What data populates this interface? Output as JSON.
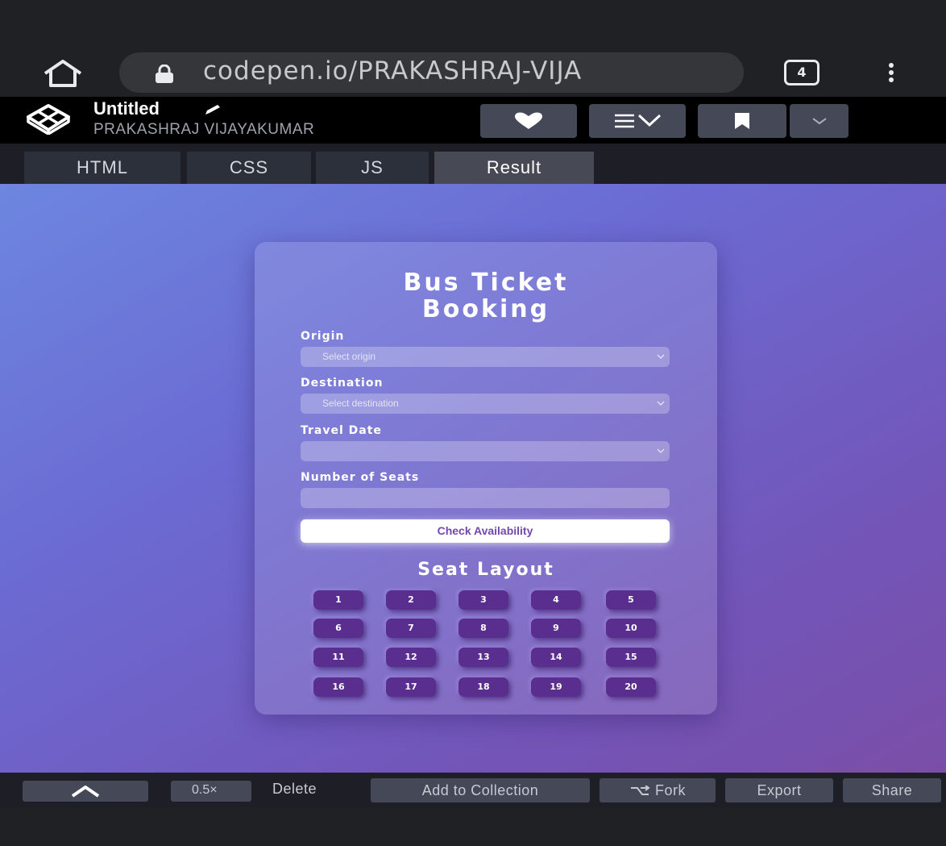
{
  "browser": {
    "url": "codepen.io/PRAKASHRAJ-VIJA",
    "tab_count": "4"
  },
  "codepen": {
    "pen_title": "Untitled",
    "author": "PRAKASHRAJ VIJAYAKUMAR",
    "tabs": [
      {
        "label": "HTML"
      },
      {
        "label": "CSS"
      },
      {
        "label": "JS"
      },
      {
        "label": "Result"
      }
    ],
    "active_tab": "Result"
  },
  "form": {
    "title_line1": "Bus Ticket",
    "title_line2": "Booking",
    "origin_label": "Origin",
    "origin_placeholder": "Select origin",
    "destination_label": "Destination",
    "destination_placeholder": "Select destination",
    "date_label": "Travel Date",
    "date_value": "",
    "seats_label": "Number of Seats",
    "seats_value": "",
    "check_button": "Check Availability",
    "seat_layout_title": "Seat Layout",
    "seats": [
      "1",
      "2",
      "3",
      "4",
      "5",
      "6",
      "7",
      "8",
      "9",
      "10",
      "11",
      "12",
      "13",
      "14",
      "15",
      "16",
      "17",
      "18",
      "19",
      "20"
    ]
  },
  "footer": {
    "zoom": "0.5×",
    "delete": "Delete",
    "add_to_collection": "Add to Collection",
    "fork": "Fork",
    "export": "Export",
    "share": "Share"
  },
  "colors": {
    "gradient_start": "#6d86df",
    "gradient_end": "#7a4ea8",
    "seat_bg": "#5a2e8f",
    "button_text": "#7448b0"
  }
}
